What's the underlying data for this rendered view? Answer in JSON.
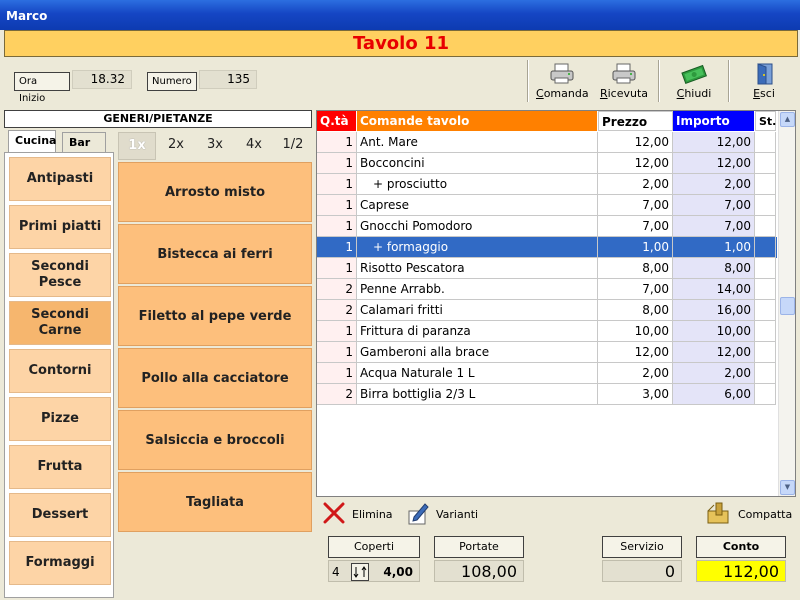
{
  "window": {
    "title": "Marco"
  },
  "header": {
    "title": "Tavolo 11"
  },
  "info": {
    "ora_inizio_label": "Ora Inizio",
    "ora_inizio_value": "18.32",
    "numero_label": "Numero",
    "numero_value": "135"
  },
  "toolbar": [
    {
      "label": "Comanda",
      "icon": "printer-icon"
    },
    {
      "label": "Ricevuta",
      "icon": "printer-icon"
    },
    {
      "label": "Chiudi",
      "icon": "money-icon"
    },
    {
      "label": "Esci",
      "icon": "door-icon"
    }
  ],
  "left": {
    "title": "GENERI/PIETANZE",
    "tabs": [
      "Cucina",
      "Bar"
    ],
    "active_tab": "Cucina",
    "multipliers": [
      "1x",
      "2x",
      "3x",
      "4x",
      "1/2"
    ],
    "categories": [
      "Antipasti",
      "Primi piatti",
      "Secondi Pesce",
      "Secondi Carne",
      "Contorni",
      "Pizze",
      "Frutta",
      "Dessert",
      "Formaggi"
    ],
    "selected_category": "Secondi Carne",
    "dishes": [
      "Arrosto misto",
      "Bistecca ai ferri",
      "Filetto al pepe verde",
      "Pollo alla cacciatore",
      "Salsiccia e broccoli",
      "Tagliata"
    ]
  },
  "table": {
    "headers": {
      "qta": "Q.tà",
      "desc": "Comande tavolo",
      "prezzo": "Prezzo",
      "importo": "Importo",
      "st": "St."
    },
    "header_colors": {
      "qta": "#ff0000",
      "desc": "#ff8000",
      "importo": "#0000ff"
    },
    "rows": [
      {
        "qta": "1",
        "desc": "Ant. Mare",
        "prezzo": "12,00",
        "importo": "12,00",
        "selected": false
      },
      {
        "qta": "1",
        "desc": "Bocconcini",
        "prezzo": "12,00",
        "importo": "12,00",
        "selected": false
      },
      {
        "qta": "1",
        "desc": "+ prosciutto",
        "prezzo": "2,00",
        "importo": "2,00",
        "selected": false,
        "indent": true
      },
      {
        "qta": "1",
        "desc": "Caprese",
        "prezzo": "7,00",
        "importo": "7,00",
        "selected": false
      },
      {
        "qta": "1",
        "desc": "Gnocchi Pomodoro",
        "prezzo": "7,00",
        "importo": "7,00",
        "selected": false
      },
      {
        "qta": "1",
        "desc": "+ formaggio",
        "prezzo": "1,00",
        "importo": "1,00",
        "selected": true,
        "indent": true
      },
      {
        "qta": "1",
        "desc": "Risotto Pescatora",
        "prezzo": "8,00",
        "importo": "8,00",
        "selected": false
      },
      {
        "qta": "2",
        "desc": "Penne Arrabb.",
        "prezzo": "7,00",
        "importo": "14,00",
        "selected": false
      },
      {
        "qta": "2",
        "desc": "Calamari fritti",
        "prezzo": "8,00",
        "importo": "16,00",
        "selected": false
      },
      {
        "qta": "1",
        "desc": "Frittura di paranza",
        "prezzo": "10,00",
        "importo": "10,00",
        "selected": false
      },
      {
        "qta": "1",
        "desc": "Gamberoni alla brace",
        "prezzo": "12,00",
        "importo": "12,00",
        "selected": false
      },
      {
        "qta": "1",
        "desc": "Acqua Naturale 1 L",
        "prezzo": "2,00",
        "importo": "2,00",
        "selected": false
      },
      {
        "qta": "2",
        "desc": "Birra bottiglia 2/3 L",
        "prezzo": "3,00",
        "importo": "6,00",
        "selected": false
      }
    ]
  },
  "actions": {
    "elimina": "Elimina",
    "varianti": "Varianti",
    "compatta": "Compatta"
  },
  "totals": {
    "coperti_label": "Coperti",
    "coperti_count": "4",
    "coperti_value": "4,00",
    "portate_label": "Portate",
    "portate_value": "108,00",
    "servizio_label": "Servizio",
    "servizio_value": "0",
    "conto_label": "Conto",
    "conto_value": "112,00",
    "conto_color": "#ffff00"
  }
}
